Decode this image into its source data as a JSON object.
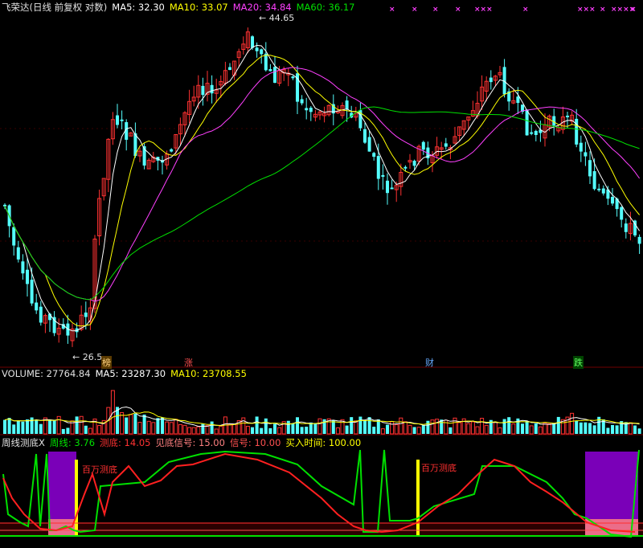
{
  "main_header": {
    "name": "飞荣达(日线 前复权 对数)",
    "ma5": "MA5: 32.30",
    "ma10": "MA10: 33.07",
    "ma20": "MA20: 34.84",
    "ma60": "MA60: 36.17"
  },
  "price_annotations": {
    "high": "44.65",
    "low": "26.5"
  },
  "badges": [
    "榜",
    "涨",
    "财",
    "跌"
  ],
  "x_marks": [
    "×",
    "×",
    "×",
    "×",
    "×××",
    "×",
    "×××",
    "×",
    "××××",
    "×"
  ],
  "volume_header": {
    "volume": "VOLUME: 27764.84",
    "ma5": "MA5: 23287.30",
    "ma10": "MA10: 23708.55"
  },
  "indicator_header": {
    "name": "周线测底X",
    "zhouxian": "周线: 3.76",
    "cedi": "测底: 14.05",
    "jiandi": "见底信号: 15.00",
    "xinhao": "信号: 10.00",
    "mairu": "买入时间: 100.00"
  },
  "indicator_labels": [
    "百万测底",
    "百万测底"
  ],
  "colors": {
    "up": "#ff3232",
    "down": "#54ffff",
    "ma5": "#ffffff",
    "ma10": "#ffff00",
    "ma20": "#ff40ff",
    "ma60": "#00e000",
    "purple": "#7a00b8",
    "pink": "#ff8080"
  }
}
